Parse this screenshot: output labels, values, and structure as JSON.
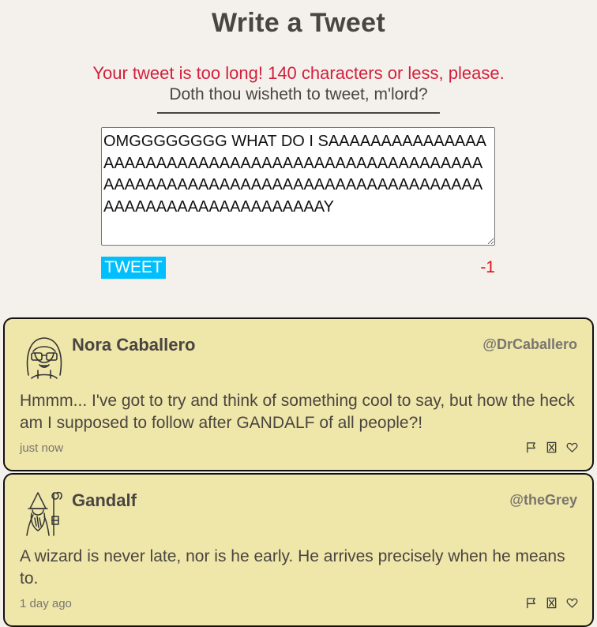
{
  "header": {
    "title": "Write a Tweet",
    "error": "Your tweet is too long! 140 characters or less, please.",
    "prompt": "Doth thou wisheth to tweet, m'lord?"
  },
  "composer": {
    "text": "OMGGGGGGGG WHAT DO I SAAAAAAAAAAAAAAAAAAAAAAAAAAAAAAAAAAAAAAAAAAAAAAAAAAAAAAAAAAAAAAAAAAAAAAAAAAAAAAAAAAAAAAAAAAAAAAAAAAAAAAAAAAAAY",
    "button_label": "TWEET",
    "remaining": "-1"
  },
  "tweets": [
    {
      "name": "Nora Caballero",
      "handle": "@DrCaballero",
      "text": "Hmmm... I've got to try and think of something cool to say, but how the heck am I supposed to follow after GANDALF of all people?!",
      "time": "just now",
      "avatar_icon": "woman-with-glasses-icon"
    },
    {
      "name": "Gandalf",
      "handle": "@theGrey",
      "text": "A wizard is never late, nor is he early. He arrives precisely when he means to.",
      "time": "1 day ago",
      "avatar_icon": "wizard-icon"
    }
  ],
  "icons": {
    "flag": "flag-icon",
    "retweet": "hourglass-icon",
    "like": "heart-icon"
  },
  "colors": {
    "background": "#f4f1ec",
    "card": "#efe6aa",
    "error": "#d21f3c",
    "button": "#00bfff",
    "counter": "#e0101a",
    "text": "#4a4540"
  }
}
